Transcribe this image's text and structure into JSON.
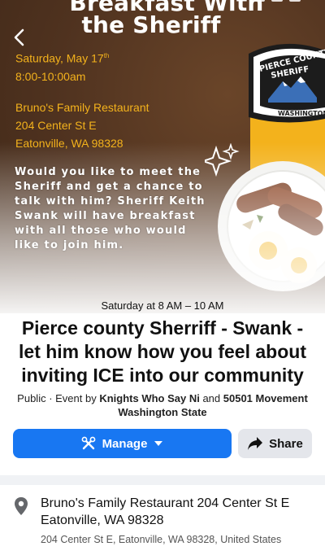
{
  "hero": {
    "title_line1": "Breakfast With",
    "title_line2": "the Sheriff",
    "date": "Saturday, May 17",
    "date_suffix": "th",
    "time": "8:00-10:00am",
    "venue": "Bruno's Family Restaurant",
    "street": "204 Center St E",
    "city": "Eatonville, WA 98328",
    "invitation": "Would you like to meet the Sheriff and get a chance to talk with him? Sheriff Keith Swank will have breakfast with all those who would like to join him.",
    "badge_top": "PIERCE COUNTY",
    "badge_mid": "SHERIFF",
    "badge_bottom": "WASHINGTON"
  },
  "event": {
    "time": "Saturday at 8 AM – 10 AM",
    "title": "Pierce county Sherriff - Swank - let him know how you feel about inviting ICE into our community",
    "meta_prefix": "Public · Event by ",
    "host1": "Knights Who Say Ni",
    "meta_and": " and ",
    "host2": "50501 Movement Washington State"
  },
  "actions": {
    "manage_label": "Manage",
    "share_label": "Share"
  },
  "location": {
    "name": "Bruno's Family Restaurant 204 Center St E Eatonville, WA 98328",
    "address": "204 Center St E, Eatonville, WA 98328, United States"
  },
  "colors": {
    "brand_blue": "#1877f2",
    "flyer_brown": "#5b3a24",
    "flyer_gold": "#f3b21c"
  },
  "icons": {
    "back": "chevron-left-icon",
    "manage": "tools-icon",
    "dropdown": "caret-down-icon",
    "share": "share-arrow-icon",
    "location": "map-pin-icon"
  }
}
